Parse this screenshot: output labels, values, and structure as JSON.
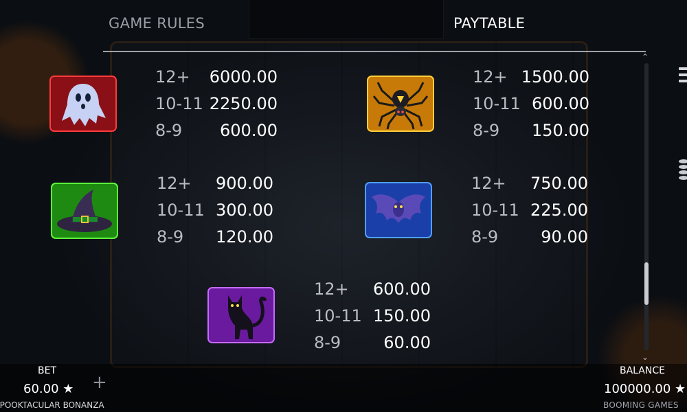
{
  "tabs": {
    "rules": "GAME RULES",
    "paytable": "PAYTABLE"
  },
  "paytable": [
    {
      "symbol": "ghost-icon",
      "rows": [
        {
          "count": "12+",
          "pay": "6000.00"
        },
        {
          "count": "10-11",
          "pay": "2250.00"
        },
        {
          "count": "8-9",
          "pay": "600.00"
        }
      ]
    },
    {
      "symbol": "spider-icon",
      "rows": [
        {
          "count": "12+",
          "pay": "1500.00"
        },
        {
          "count": "10-11",
          "pay": "600.00"
        },
        {
          "count": "8-9",
          "pay": "150.00"
        }
      ]
    },
    {
      "symbol": "witch-hat-icon",
      "rows": [
        {
          "count": "12+",
          "pay": "900.00"
        },
        {
          "count": "10-11",
          "pay": "300.00"
        },
        {
          "count": "8-9",
          "pay": "120.00"
        }
      ]
    },
    {
      "symbol": "bat-icon",
      "rows": [
        {
          "count": "12+",
          "pay": "750.00"
        },
        {
          "count": "10-11",
          "pay": "225.00"
        },
        {
          "count": "8-9",
          "pay": "90.00"
        }
      ]
    },
    {
      "symbol": "black-cat-icon",
      "rows": [
        {
          "count": "12+",
          "pay": "600.00"
        },
        {
          "count": "10-11",
          "pay": "150.00"
        },
        {
          "count": "8-9",
          "pay": "60.00"
        }
      ]
    }
  ],
  "footer": {
    "bet_label": "BET",
    "bet_value": "60.00 ★",
    "plus": "+",
    "game_name": "SPOOKTACULAR BONANZA",
    "balance_label": "BALANCE",
    "balance_value": "100000.00 ★",
    "brand": "BOOMING GAMES"
  },
  "icons": {
    "scroll_up": "chevron-up-icon",
    "scroll_down": "chevron-down-icon",
    "menu": "menu-icon",
    "coins": "coin-stack-icon"
  },
  "colors": {
    "ghost_tile": "#d81f2a",
    "spider_tile": "#e8a018",
    "hat_tile": "#39c41e",
    "bat_tile": "#2a6fe0",
    "cat_tile": "#a236e0"
  }
}
